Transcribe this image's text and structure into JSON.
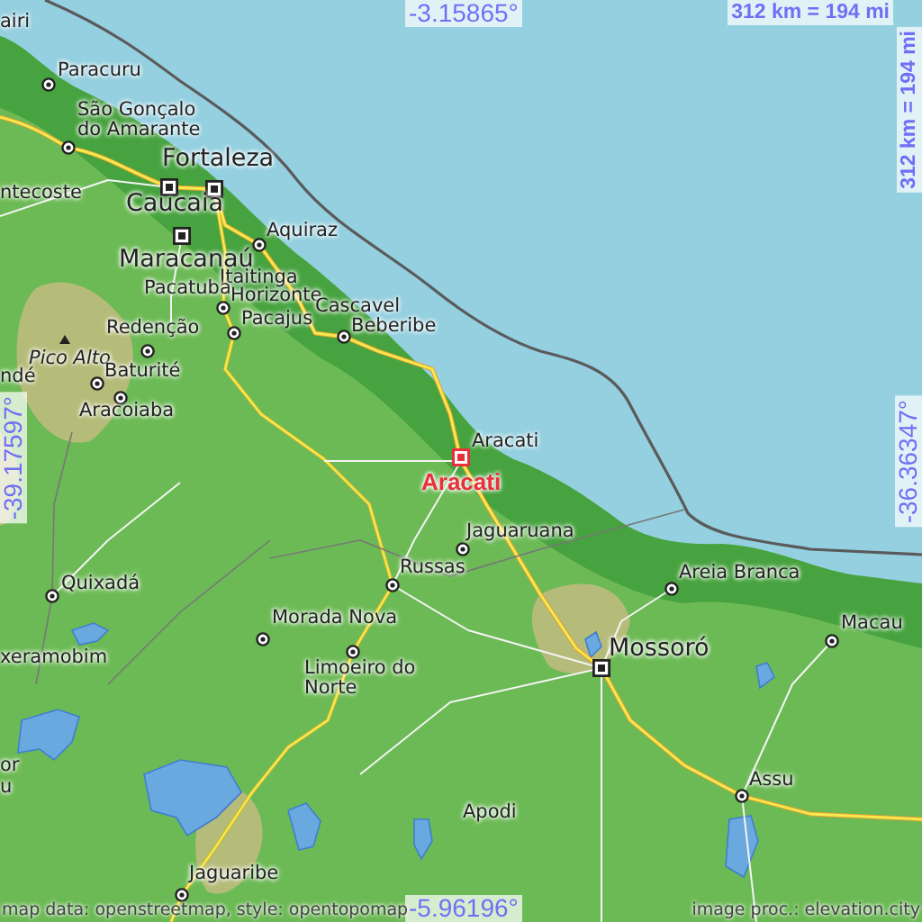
{
  "map": {
    "coordinates": {
      "top": "-3.15865°",
      "left": "-39.17597°",
      "right": "-36.36347°",
      "bottom": "-5.96196°"
    },
    "scale": [
      "312 km = 194 mi",
      "312 km = 194 mi"
    ],
    "places": [
      {
        "name": "airi",
        "kind": "town"
      },
      {
        "name": "Paracuru",
        "kind": "town"
      },
      {
        "name": "São Gonçalo do Amarante",
        "kind": "town"
      },
      {
        "name": "Fortaleza",
        "kind": "city"
      },
      {
        "name": "ntecoste",
        "kind": "town"
      },
      {
        "name": "Caucaia",
        "kind": "city"
      },
      {
        "name": "Aquiraz",
        "kind": "town"
      },
      {
        "name": "Maracanaú",
        "kind": "city"
      },
      {
        "name": "Itaitinga",
        "kind": "town"
      },
      {
        "name": "Pacatuba",
        "kind": "town"
      },
      {
        "name": "Horizonte",
        "kind": "town"
      },
      {
        "name": "Cascavel",
        "kind": "town"
      },
      {
        "name": "Redenção",
        "kind": "town"
      },
      {
        "name": "Pacajus",
        "kind": "town"
      },
      {
        "name": "Beberibe",
        "kind": "town"
      },
      {
        "name": "Pico Alto",
        "kind": "peak"
      },
      {
        "name": "Baturité",
        "kind": "town"
      },
      {
        "name": "ndé",
        "kind": "town"
      },
      {
        "name": "Aracoiaba",
        "kind": "town"
      },
      {
        "name": "Aracati",
        "kind": "town"
      },
      {
        "name": "Aracati",
        "kind": "highlight"
      },
      {
        "name": "Jaguaruana",
        "kind": "town"
      },
      {
        "name": "Russas",
        "kind": "town"
      },
      {
        "name": "Quixadá",
        "kind": "town"
      },
      {
        "name": "Areia Branca",
        "kind": "town"
      },
      {
        "name": "Morada Nova",
        "kind": "town"
      },
      {
        "name": "Macau",
        "kind": "town"
      },
      {
        "name": "Mossoró",
        "kind": "city"
      },
      {
        "name": "xeramobim",
        "kind": "town"
      },
      {
        "name": "Limoeiro do Norte",
        "kind": "town"
      },
      {
        "name": "or",
        "kind": "town"
      },
      {
        "name": "u",
        "kind": "town"
      },
      {
        "name": "Assu",
        "kind": "town"
      },
      {
        "name": "Apodi",
        "kind": "town"
      },
      {
        "name": "Jaguaribe",
        "kind": "town"
      }
    ],
    "attribution": {
      "data": "map data: openstreetmap, style: opentopomap",
      "image": "image proc.: elevation.city"
    }
  }
}
